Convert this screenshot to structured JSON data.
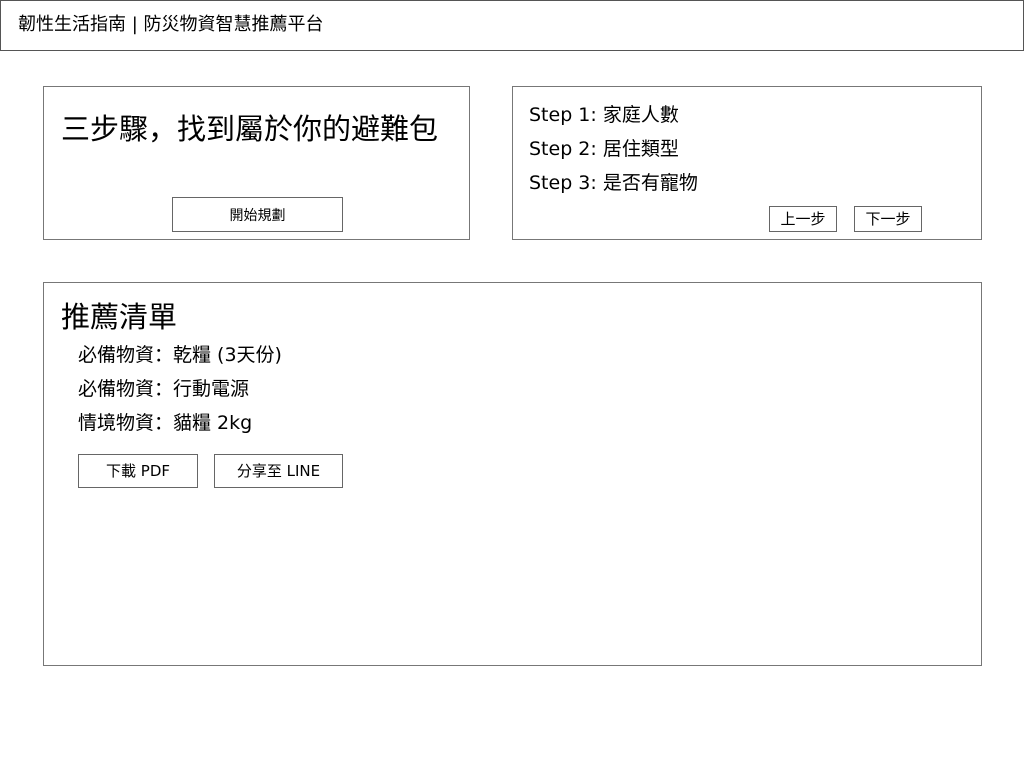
{
  "header": {
    "title": "韌性生活指南 | 防災物資智慧推薦平台"
  },
  "hero": {
    "title": "三步驟，找到屬於你的避難包",
    "start_button": "開始規劃"
  },
  "steps": {
    "items": [
      "Step 1: 家庭人數",
      "Step 2: 居住類型",
      "Step 3: 是否有寵物"
    ],
    "prev_button": "上一步",
    "next_button": "下一步"
  },
  "results": {
    "title": "推薦清單",
    "items": [
      "必備物資：乾糧 (3天份)",
      "必備物資：行動電源",
      "情境物資：貓糧 2kg"
    ],
    "download_button": "下載 PDF",
    "share_button": "分享至 LINE"
  }
}
